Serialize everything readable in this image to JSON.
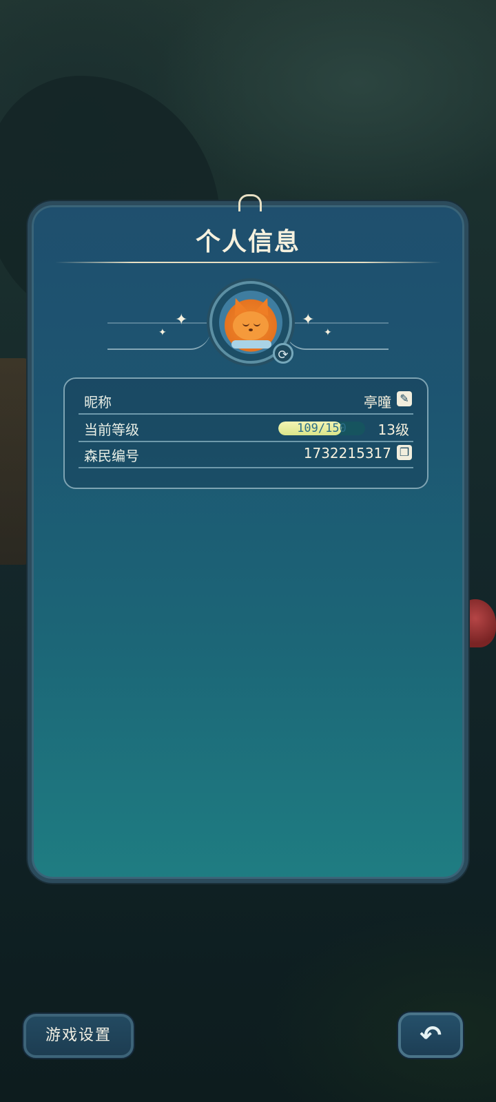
{
  "panel": {
    "title": "个人信息"
  },
  "avatar": {
    "icon": "fox-avatar",
    "refresh_icon": "refresh-icon"
  },
  "info": {
    "nickname": {
      "label": "昵称",
      "value": "亭曈",
      "icon": "edit-icon"
    },
    "level": {
      "label": "当前等级",
      "xp_current": 109,
      "xp_max": 150,
      "xp_text": "109/150",
      "value": "13级"
    },
    "resident_id": {
      "label": "森民编号",
      "value": "1732215317",
      "icon": "copy-icon"
    }
  },
  "buttons": {
    "settings_label": "游戏设置",
    "back_icon": "back-arrow-icon"
  },
  "colors": {
    "panel_top": "#1f4f6e",
    "panel_bottom": "#1f7d82",
    "text_cream": "#f6f1de",
    "xp_fill": "#dbe58a"
  }
}
